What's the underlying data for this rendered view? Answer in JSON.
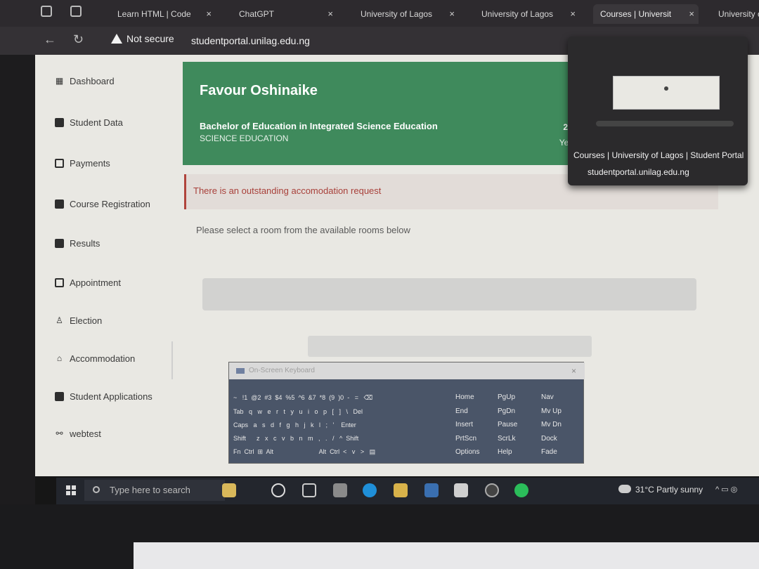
{
  "browser": {
    "tabs": [
      {
        "label": "Learn HTML | Code",
        "close": "×"
      },
      {
        "label": "ChatGPT",
        "close": "×"
      },
      {
        "label": "University of Lagos",
        "close": "×"
      },
      {
        "label": "University of Lagos",
        "close": "×"
      },
      {
        "label": "Courses | Universit",
        "close": "×"
      },
      {
        "label": "University o",
        "close": ""
      }
    ],
    "security_label": "Not secure",
    "url": "studentportal.unilag.edu.ng"
  },
  "sidebar": {
    "items": [
      {
        "label": "Dashboard",
        "icon": "grid-icon"
      },
      {
        "label": "Student Data",
        "icon": "id-card-icon"
      },
      {
        "label": "Payments",
        "icon": "card-icon"
      },
      {
        "label": "Course Registration",
        "icon": "book-icon"
      },
      {
        "label": "Results",
        "icon": "results-icon"
      },
      {
        "label": "Appointment",
        "icon": "calendar-icon"
      },
      {
        "label": "Election",
        "icon": "user-icon"
      },
      {
        "label": "Accommodation",
        "icon": "home-icon"
      },
      {
        "label": "Student Applications",
        "icon": "edit-icon"
      },
      {
        "label": "webtest",
        "icon": "handshake-icon"
      }
    ]
  },
  "banner": {
    "name": "Favour Oshinaike",
    "degree": "Bachelor of Education in Integrated Science Education",
    "faculty": "SCIENCE EDUCATION",
    "level_number": "2",
    "level_label": "Year"
  },
  "alert": {
    "text": "There is an outstanding accomodation request"
  },
  "instruction": "Please select a room from the available rooms below",
  "hover_card": {
    "title": "Courses | University of Lagos | Student Portal",
    "host": "studentportal.unilag.edu.ng"
  },
  "keyboard": {
    "title": "On-Screen Keyboard",
    "close": "×",
    "rows": [
      "~   !1  @2  #3  $4  %5  ^6  &7  *8  (9  )0  -   =   ⌫",
      "Tab   q   w   e   r   t   y   u   i   o   p   [   ]   \\   Del",
      "Caps   a   s   d   f   g   h   j   k   l   ;   '    Enter",
      "Shift      z   x   c   v   b   n   m   ,   .   /   ^  Shift",
      "Fn  Ctrl  ⊞  Alt                          Alt  Ctrl  <   v   >   ▤"
    ],
    "nav_col1": [
      "Home",
      "End",
      "Insert",
      "PrtScn",
      "Options"
    ],
    "nav_col2": [
      "PgUp",
      "PgDn",
      "Pause",
      "ScrLk",
      "Help"
    ],
    "nav_col3": [
      "Nav",
      "Mv Up",
      "Mv Dn",
      "Dock",
      "Fade"
    ]
  },
  "taskbar": {
    "search_placeholder": "Type here to search",
    "weather": "31°C  Partly sunny",
    "tray": "^  ▭  ◎"
  }
}
